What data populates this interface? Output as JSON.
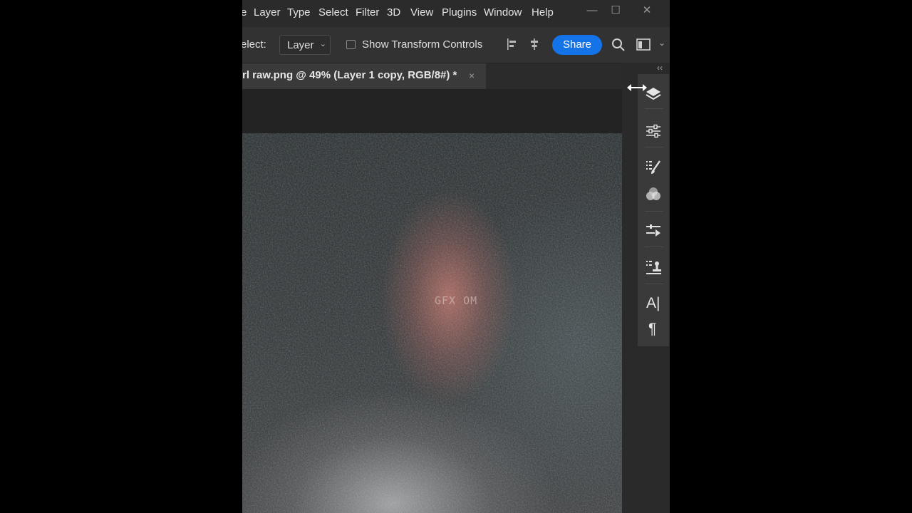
{
  "menu": {
    "cut_item": "e",
    "items": [
      "Layer",
      "Type",
      "Select",
      "Filter",
      "3D",
      "View",
      "Plugins",
      "Window",
      "Help"
    ]
  },
  "window_controls": {
    "minimize": "—",
    "maximize": "☐",
    "close": "✕"
  },
  "options_bar": {
    "auto_select_label": "elect:",
    "auto_select_value": "Layer",
    "show_transform_label": "Show Transform Controls",
    "show_transform_checked": false,
    "share_label": "Share",
    "icons": [
      "align-left-icon",
      "align-center-icon",
      "search-icon",
      "workspace-icon"
    ]
  },
  "document_tab": {
    "title": "rl raw.png @ 49% (Layer 1 copy, RGB/8#) *",
    "close": "×"
  },
  "canvas": {
    "watermark": "GFX OM"
  },
  "right_panel": {
    "icons": [
      "layers-icon",
      "adjustments-icon",
      "brush-settings-icon",
      "color-icon",
      "properties-icon",
      "clone-source-icon",
      "character-icon",
      "paragraph-icon"
    ],
    "character_glyph": "A|",
    "paragraph_glyph": "¶"
  },
  "colors": {
    "accent": "#1473e6",
    "panel_bg": "#323232",
    "menu_bg": "#2b2b2b",
    "pasteboard": "#232323"
  }
}
